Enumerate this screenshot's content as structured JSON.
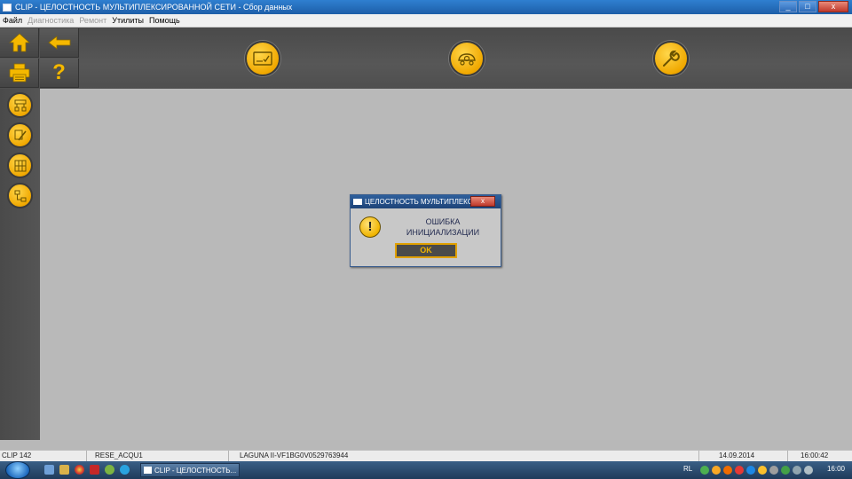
{
  "window": {
    "title": "CLIP - ЦЕЛОСТНОСТЬ МУЛЬТИПЛЕКСИРОВАННОЙ СЕТИ - Сбор данных",
    "minimize_glyph": "_",
    "maximize_glyph": "□",
    "close_glyph": "x"
  },
  "menu": {
    "items": [
      {
        "label": "Файл",
        "enabled": true
      },
      {
        "label": "Диагностика",
        "enabled": false
      },
      {
        "label": "Ремонт",
        "enabled": false
      },
      {
        "label": "Утилиты",
        "enabled": true
      },
      {
        "label": "Помощь",
        "enabled": true
      }
    ]
  },
  "toolbar": {
    "buttons": [
      {
        "name": "home-button",
        "icon": "home-icon"
      },
      {
        "name": "back-button",
        "icon": "arrow-left-icon"
      },
      {
        "name": "print-button",
        "icon": "printer-icon"
      },
      {
        "name": "help-button",
        "icon": "question-icon",
        "glyph": "?"
      }
    ],
    "main_buttons": [
      {
        "name": "identification-button",
        "icon": "id-card-icon"
      },
      {
        "name": "vehicle-button",
        "icon": "vehicle-icon"
      },
      {
        "name": "tools-button",
        "icon": "wrench-icon"
      }
    ]
  },
  "sidebar": {
    "buttons": [
      {
        "name": "network-diagram-button",
        "icon": "network-icon"
      },
      {
        "name": "edit-diagram-button",
        "icon": "edit-icon"
      },
      {
        "name": "grid-diagram-button",
        "icon": "grid-icon"
      },
      {
        "name": "flow-diagram-button",
        "icon": "flow-icon"
      }
    ]
  },
  "dialog": {
    "title": "ЦЕЛОСТНОСТЬ МУЛЬТИПЛЕКСИ...",
    "close_glyph": "x",
    "icon": "warning-icon",
    "warning_glyph": "!",
    "message_line1": "ОШИБКА",
    "message_line2": "ИНИЦИАЛИЗАЦИИ",
    "ok_label": "OK"
  },
  "statusbar": {
    "version": "CLIP 142",
    "module": "RESE_ACQU1",
    "vehicle": "LAGUNA II-VF1BG0V0529763944",
    "date": "14.09.2014",
    "time": "16:00:42"
  },
  "taskbar": {
    "task_label": "CLIP - ЦЕЛОСТНОСТЬ...",
    "language": "RL",
    "clock": "16:00"
  },
  "colors": {
    "accent_yellow": "#f0a800",
    "toolbar_dark": "#4f4f4f",
    "workspace_gray": "#b9b9b9",
    "titlebar_blue": "#1d5ea8"
  }
}
